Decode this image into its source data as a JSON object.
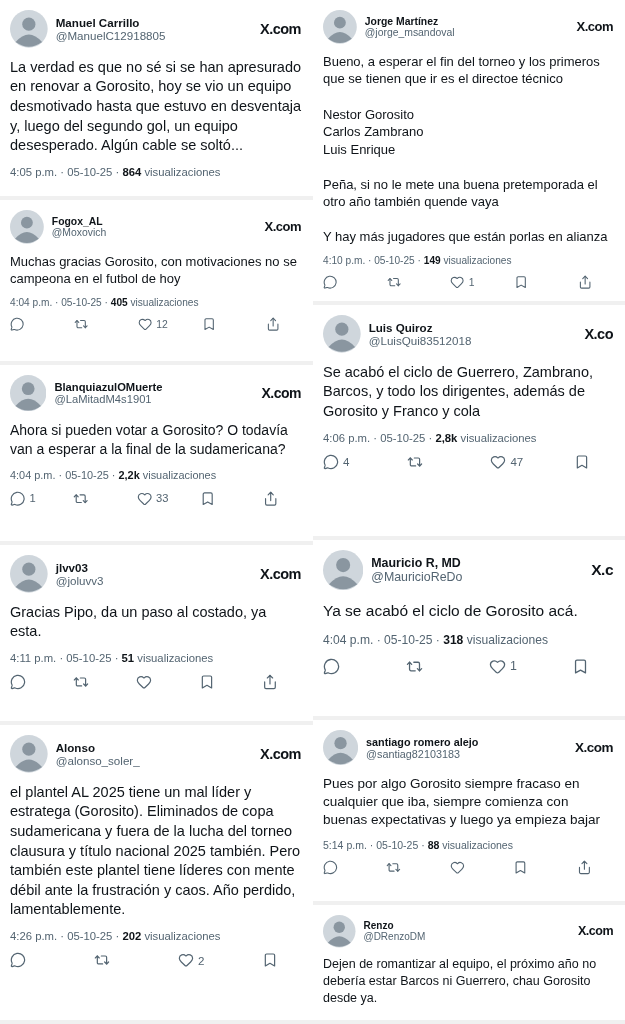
{
  "columns": [
    {
      "tweets": [
        {
          "name": "Manuel Carrillo",
          "handle": "@ManuelC12918805",
          "site": "X.com",
          "text": "La verdad es que no sé si se han apresurado en renovar a Gorosito, hoy se vio un equipo desmotivado hasta que estuvo en desventaja y, luego del segundo gol, un equipo desesperado. Algún cable se soltó...",
          "meta": "4:05 p.m. · 05-10-25 · **864** visualizaciones"
        },
        {
          "name": "Fogox_AL",
          "handle": "@Moxovich",
          "site": "X.com",
          "text": "Muchas gracias Gorosito, con motivaciones no se campeona en el futbol de hoy",
          "meta": "4:04 p.m. · 05-10-25 · **405** visualizaciones",
          "actions": [
            {
              "kind": "reply"
            },
            {
              "kind": "repost"
            },
            {
              "kind": "like",
              "count": "12"
            },
            {
              "kind": "bookmark"
            },
            {
              "kind": "share"
            }
          ]
        },
        {
          "name": "BlanquiazulOMuerte",
          "handle": "@LaMitadM4s1901",
          "site": "X.com",
          "text": "Ahora si pueden votar a Gorosito? O todavía van a esperar a la final de la sudamericana?",
          "meta": "4:04 p.m. · 05-10-25 · **2,2k** visualizaciones",
          "actions": [
            {
              "kind": "reply",
              "count": "1"
            },
            {
              "kind": "repost"
            },
            {
              "kind": "like",
              "count": "33"
            },
            {
              "kind": "bookmark"
            },
            {
              "kind": "share"
            }
          ]
        },
        {
          "name": "jlvv03",
          "handle": "@joluvv3",
          "site": "X.com",
          "text": "Gracias Pipo, da un paso al costado, ya esta.",
          "meta": "4:11 p.m. · 05-10-25 · **51** visualizaciones",
          "actions": [
            {
              "kind": "reply"
            },
            {
              "kind": "repost"
            },
            {
              "kind": "like"
            },
            {
              "kind": "bookmark"
            },
            {
              "kind": "share"
            }
          ]
        },
        {
          "name": "Alonso",
          "handle": "@alonso_soler_",
          "site": "X.com",
          "text": "el plantel AL 2025 tiene un mal líder y estratega (Gorosito). Eliminados de copa sudamericana y fuera de la lucha del torneo clausura y título nacional 2025 también. Pero también este plantel tiene líderes con mente débil ante la frustración y caos. Año perdido, lamentablemente.",
          "meta": "4:26 p.m. · 05-10-25 · **202** visualizaciones",
          "actions": [
            {
              "kind": "reply"
            },
            {
              "kind": "repost"
            },
            {
              "kind": "like",
              "count": "2"
            },
            {
              "kind": "bookmark"
            }
          ]
        }
      ]
    },
    {
      "tweets": [
        {
          "name": "Jorge Martínez",
          "handle": "@jorge_msandoval",
          "site": "X.com",
          "text": "Bueno, a esperar el fin del torneo y los primeros que se tienen que ir es el directoe técnico\n\nNestor Gorosito\nCarlos Zambrano\nLuis Enrique\n\nPeña, si no le mete una buena pretemporada el otro año también quende vaya\n\nY hay más  jugadores que están porlas en alianza",
          "meta": "4:10 p.m. · 05-10-25 · **149** visualizaciones",
          "actions": [
            {
              "kind": "reply"
            },
            {
              "kind": "repost"
            },
            {
              "kind": "like",
              "count": "1"
            },
            {
              "kind": "bookmark"
            },
            {
              "kind": "share"
            }
          ]
        },
        {
          "name": "Luis Quiroz",
          "handle": "@LuisQui83512018",
          "site": "X.co",
          "text": "Se acabó el ciclo de Guerrero, Zambrano, Barcos,  y todo los dirigentes,  además de Gorosito y Franco y cola",
          "meta": "4:06 p.m. · 05-10-25 · **2,8k** visualizaciones",
          "actions": [
            {
              "kind": "reply",
              "count": "4"
            },
            {
              "kind": "repost"
            },
            {
              "kind": "like",
              "count": "47"
            },
            {
              "kind": "bookmark"
            }
          ]
        },
        {
          "name": "Mauricio R, MD",
          "handle": "@MauricioReDo",
          "site": "X.c",
          "text": "Ya se acabó el ciclo de Gorosito acá.",
          "meta": "4:04 p.m. · 05-10-25 · **318** visualizaciones",
          "actions": [
            {
              "kind": "reply"
            },
            {
              "kind": "repost"
            },
            {
              "kind": "like",
              "count": "1"
            },
            {
              "kind": "bookmark"
            }
          ]
        },
        {
          "name": "santiago romero alejo",
          "handle": "@santiag82103183",
          "site": "X.com",
          "text": "Pues por algo Gorosito siempre fracaso en cualquier que iba, siempre comienza con buenas expectativas y luego ya empieza bajar",
          "meta": "5:14 p.m. · 05-10-25 · **88** visualizaciones",
          "actions": [
            {
              "kind": "reply"
            },
            {
              "kind": "repost"
            },
            {
              "kind": "like"
            },
            {
              "kind": "bookmark"
            },
            {
              "kind": "share"
            }
          ]
        },
        {
          "name": "Renzo",
          "handle": "@DRenzoDM",
          "site": "X.com",
          "text": "Dejen de romantizar al equipo, el próximo año no debería estar Barcos ni Guerrero, chau Gorosito desde ya."
        }
      ]
    }
  ]
}
